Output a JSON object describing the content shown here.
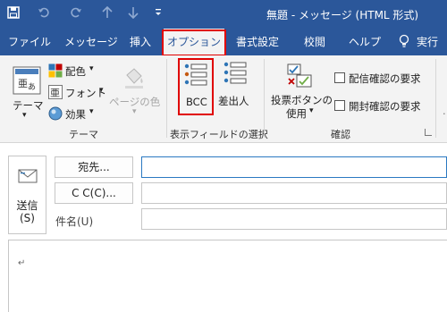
{
  "window": {
    "title": "無題 - メッセージ (HTML 形式)"
  },
  "quick_access": {
    "save_icon": "save-icon",
    "undo_icon": "undo-icon",
    "redo_icon": "redo-icon",
    "up_icon": "up-arrow-icon",
    "down_icon": "down-arrow-icon",
    "customize_icon": "customize-icon"
  },
  "tabs": [
    {
      "label": "ファイル"
    },
    {
      "label": "メッセージ"
    },
    {
      "label": "挿入"
    },
    {
      "label": "オプション"
    },
    {
      "label": "書式設定"
    },
    {
      "label": "校閲"
    },
    {
      "label": "ヘルプ"
    },
    {
      "label": "実行"
    }
  ],
  "ribbon": {
    "theme_group": {
      "theme_label": "テーマ",
      "color_label": "配色",
      "font_label": "フォント",
      "effect_label": "効果",
      "page_color_label": "ページの色",
      "group_label": "テーマ"
    },
    "fields_group": {
      "bcc_label": "BCC",
      "from_label": "差出人",
      "group_label": "表示フィールドの選択"
    },
    "tracking_group": {
      "vote_label_line1": "投票ボタンの",
      "vote_label_line2": "使用",
      "delivery_receipt_label": "配信確認の要求",
      "read_receipt_label": "開封確認の要求",
      "group_label": "確認"
    }
  },
  "compose": {
    "send_label_line1": "送信",
    "send_label_line2": "(S)",
    "to_button_label": "宛先...",
    "cc_button_label": "C C(C)...",
    "subject_label": "件名(U)",
    "to_value": "",
    "cc_value": "",
    "subject_value": "",
    "body_mark": "↵"
  },
  "colors": {
    "accent": "#2b579a",
    "highlight": "#e00000"
  }
}
